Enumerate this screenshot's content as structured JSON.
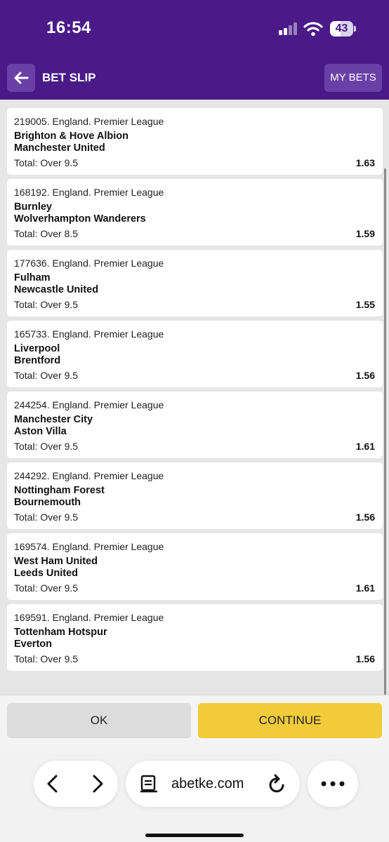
{
  "status_bar": {
    "time": "16:54",
    "battery": "43"
  },
  "header": {
    "title": "BET SLIP",
    "my_bets_label": "MY BETS"
  },
  "bets": [
    {
      "league": "219005. England. Premier League",
      "home": "Brighton & Hove Albion",
      "away": "Manchester United",
      "market": "Total: Over 9.5",
      "odds": "1.63"
    },
    {
      "league": "168192. England. Premier League",
      "home": "Burnley",
      "away": "Wolverhampton Wanderers",
      "market": "Total: Over 8.5",
      "odds": "1.59"
    },
    {
      "league": "177636. England. Premier League",
      "home": "Fulham",
      "away": "Newcastle United",
      "market": "Total: Over 9.5",
      "odds": "1.55"
    },
    {
      "league": "165733. England. Premier League",
      "home": "Liverpool",
      "away": "Brentford",
      "market": "Total: Over 9.5",
      "odds": "1.56"
    },
    {
      "league": "244254. England. Premier League",
      "home": "Manchester City",
      "away": "Aston Villa",
      "market": "Total: Over 9.5",
      "odds": "1.61"
    },
    {
      "league": "244292. England. Premier League",
      "home": "Nottingham Forest",
      "away": "Bournemouth",
      "market": "Total: Over 9.5",
      "odds": "1.56"
    },
    {
      "league": "169574. England. Premier League",
      "home": "West Ham United",
      "away": "Leeds United",
      "market": "Total: Over 9.5",
      "odds": "1.61"
    },
    {
      "league": "169591. England. Premier League",
      "home": "Tottenham Hotspur",
      "away": "Everton",
      "market": "Total: Over 9.5",
      "odds": "1.56"
    }
  ],
  "actions": {
    "ok_label": "OK",
    "continue_label": "CONTINUE"
  },
  "browser": {
    "url": "abetke.com"
  },
  "colors": {
    "header_bg": "#4a1a88",
    "header_button_bg": "#6a3fa6",
    "continue_bg": "#f2cb3c",
    "ok_bg": "#dcdcdc"
  },
  "icons": [
    "back-arrow-icon",
    "signal-icon",
    "wifi-icon",
    "battery-icon",
    "browser-back-icon",
    "browser-forward-icon",
    "reader-mode-icon",
    "reload-icon",
    "more-icon"
  ]
}
